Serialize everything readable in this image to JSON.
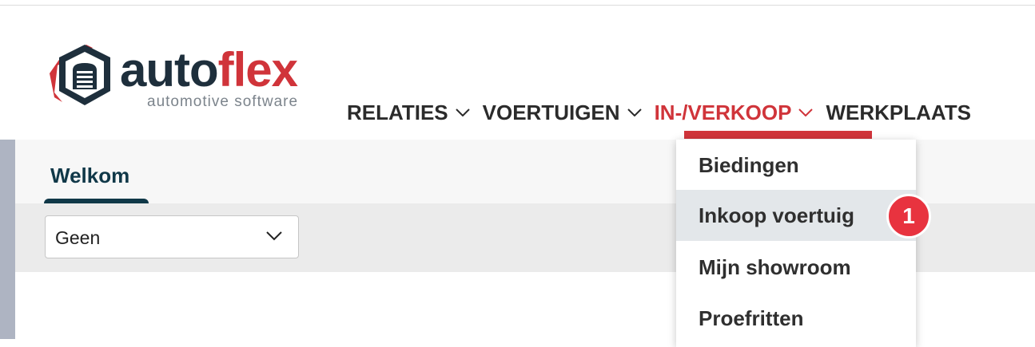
{
  "logo": {
    "word_auto": "auto",
    "word_flex": "flex",
    "tagline": "automotive software"
  },
  "nav": {
    "items": [
      {
        "label": "RELATIES",
        "has_chevron": true,
        "active": false
      },
      {
        "label": "VOERTUIGEN",
        "has_chevron": true,
        "active": false
      },
      {
        "label": "IN-/VERKOOP",
        "has_chevron": true,
        "active": true
      },
      {
        "label": "WERKPLAATS",
        "has_chevron": false,
        "active": false
      }
    ]
  },
  "tabs": {
    "welkom": "Welkom"
  },
  "filter": {
    "selected": "Geen"
  },
  "dropdown": {
    "items": [
      "Biedingen",
      "Inkoop voertuig",
      "Mijn showroom",
      "Proefritten"
    ],
    "highlighted": "Inkoop voertuig"
  },
  "badge": {
    "number": "1"
  },
  "colors": {
    "brand_red": "#d0343a",
    "brand_dark": "#1e2f3c",
    "badge_red": "#e8333f"
  },
  "icons": {
    "chevron": "chevron-down-icon",
    "logo_mark": "garage-logo-icon"
  }
}
